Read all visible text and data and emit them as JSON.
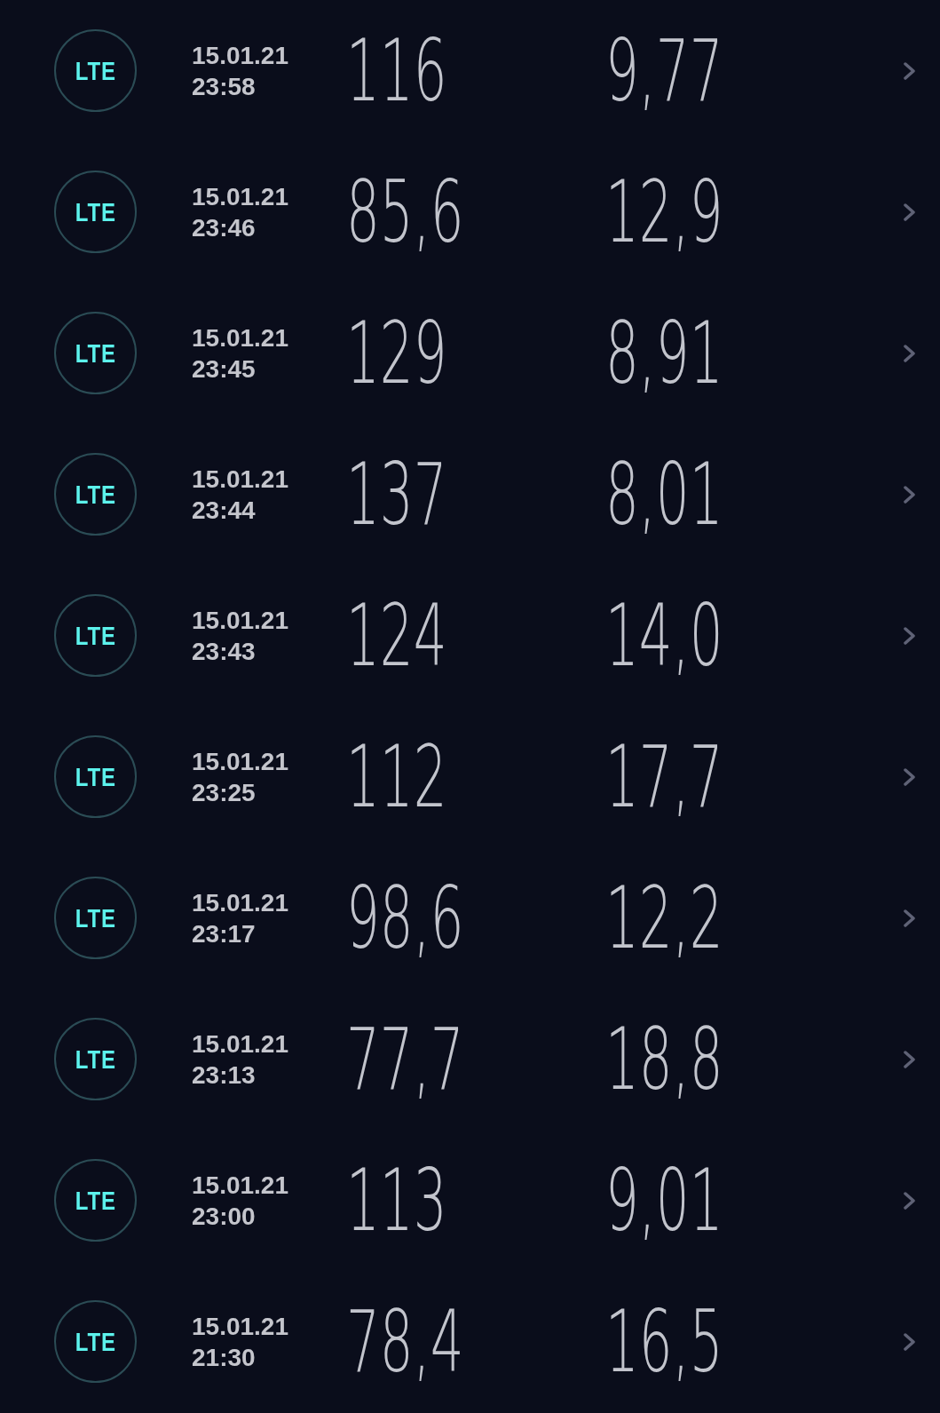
{
  "results": [
    {
      "network": "LTE",
      "date": "15.01.21",
      "time": "23:58",
      "download": "116",
      "upload": "9,77"
    },
    {
      "network": "LTE",
      "date": "15.01.21",
      "time": "23:46",
      "download": "85,6",
      "upload": "12,9"
    },
    {
      "network": "LTE",
      "date": "15.01.21",
      "time": "23:45",
      "download": "129",
      "upload": "8,91"
    },
    {
      "network": "LTE",
      "date": "15.01.21",
      "time": "23:44",
      "download": "137",
      "upload": "8,01"
    },
    {
      "network": "LTE",
      "date": "15.01.21",
      "time": "23:43",
      "download": "124",
      "upload": "14,0"
    },
    {
      "network": "LTE",
      "date": "15.01.21",
      "time": "23:25",
      "download": "112",
      "upload": "17,7"
    },
    {
      "network": "LTE",
      "date": "15.01.21",
      "time": "23:17",
      "download": "98,6",
      "upload": "12,2"
    },
    {
      "network": "LTE",
      "date": "15.01.21",
      "time": "23:13",
      "download": "77,7",
      "upload": "18,8"
    },
    {
      "network": "LTE",
      "date": "15.01.21",
      "time": "23:00",
      "download": "113",
      "upload": "9,01"
    },
    {
      "network": "LTE",
      "date": "15.01.21",
      "time": "21:30",
      "download": "78,4",
      "upload": "16,5"
    }
  ]
}
